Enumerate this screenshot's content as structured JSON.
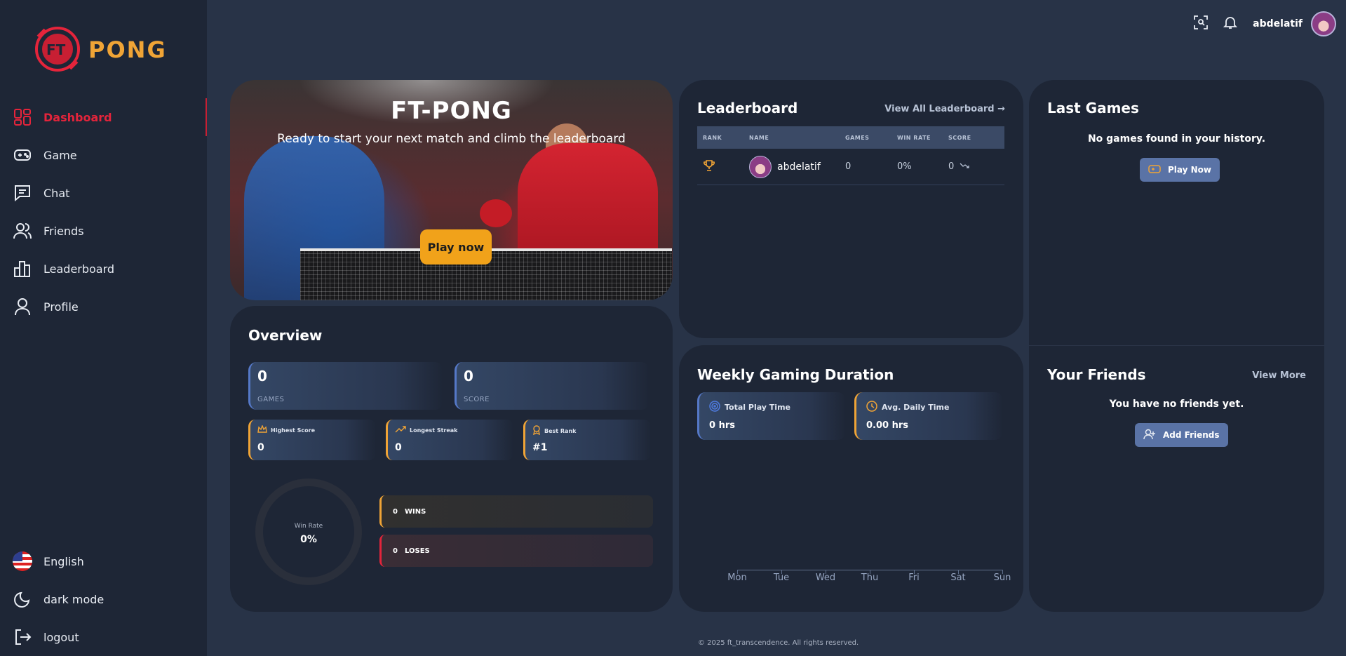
{
  "app": {
    "logo_text": "PONG",
    "logo_mark": "FT"
  },
  "sidebar": {
    "items": [
      {
        "label": "Dashboard",
        "icon": "dashboard-icon",
        "active": true
      },
      {
        "label": "Game",
        "icon": "gamepad-icon"
      },
      {
        "label": "Chat",
        "icon": "chat-icon"
      },
      {
        "label": "Friends",
        "icon": "friends-icon"
      },
      {
        "label": "Leaderboard",
        "icon": "bar-chart-icon"
      },
      {
        "label": "Profile",
        "icon": "user-icon"
      }
    ],
    "bottom": [
      {
        "label": "English",
        "icon": "us-flag-icon"
      },
      {
        "label": "dark mode",
        "icon": "moon-icon"
      },
      {
        "label": "logout",
        "icon": "logout-icon"
      }
    ]
  },
  "topbar": {
    "username": "abdelatif"
  },
  "hero": {
    "title": "FT-PONG",
    "subtitle": "Ready to start your next match and climb the leaderboard",
    "button": "Play now"
  },
  "overview": {
    "title": "Overview",
    "games": {
      "value": "0",
      "label": "GAMES"
    },
    "score": {
      "value": "0",
      "label": "SCORE"
    },
    "highest_score": {
      "label": "Highest Score",
      "value": "0"
    },
    "longest_streak": {
      "label": "Longest Streak",
      "value": "0"
    },
    "best_rank": {
      "label": "Best Rank",
      "value": "#1"
    },
    "win_rate": {
      "label": "Win Rate",
      "value": "0%"
    },
    "wins": {
      "value": "0",
      "label": "WINS"
    },
    "loses": {
      "value": "0",
      "label": "LOSES"
    }
  },
  "leaderboard": {
    "title": "Leaderboard",
    "link": "View All Leaderboard →",
    "columns": [
      "RANK",
      "NAME",
      "GAMES",
      "WIN RATE",
      "SCORE"
    ],
    "rows": [
      {
        "name": "abdelatif",
        "games": "0",
        "win_rate": "0%",
        "score": "0"
      }
    ]
  },
  "weekly": {
    "title": "Weekly Gaming Duration",
    "total": {
      "label": "Total Play Time",
      "value": "0 hrs"
    },
    "avg": {
      "label": "Avg. Daily Time",
      "value": "0.00 hrs"
    },
    "days": [
      "Mon",
      "Tue",
      "Wed",
      "Thu",
      "Fri",
      "Sat",
      "Sun"
    ]
  },
  "last_games": {
    "title": "Last Games",
    "empty": "No games found in your history.",
    "button": "Play Now"
  },
  "friends": {
    "title": "Your Friends",
    "link": "View More",
    "empty": "You have no friends yet.",
    "button": "Add Friends"
  },
  "footer": {
    "text": "© 2025 ft_transcendence. All rights reserved."
  },
  "colors": {
    "accent_red": "#e5243b",
    "accent_orange": "#f0a436",
    "panel": "#1e2636",
    "background": "#283347"
  }
}
